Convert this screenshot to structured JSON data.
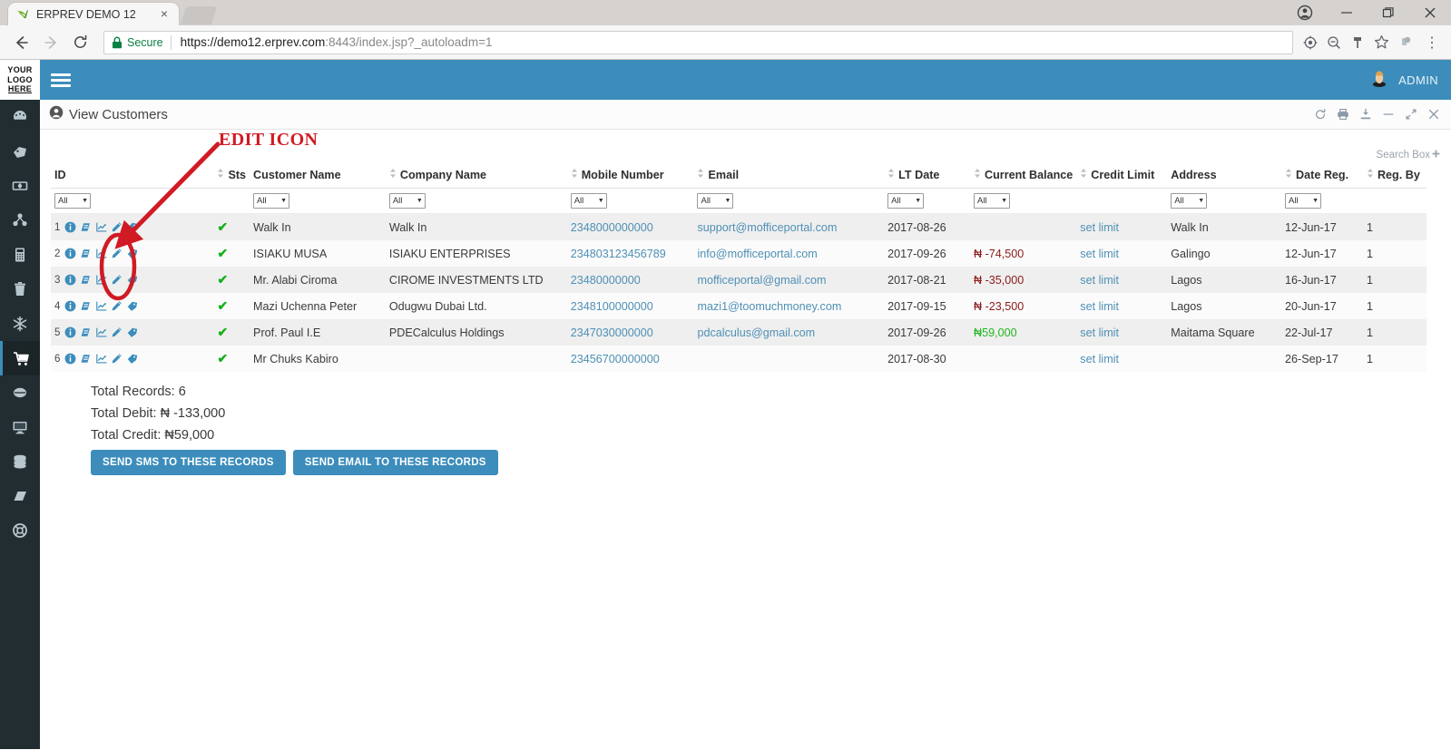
{
  "browser": {
    "tab": {
      "title": "ERPREV DEMO 12",
      "favicon": "erprev-leaf-icon",
      "close": "×"
    },
    "new_tab_label": "new-tab-button",
    "window_buttons": [
      "profile-icon",
      "minimize",
      "maximize",
      "close"
    ],
    "nav": {
      "back": "back-arrow",
      "forward": "forward-arrow",
      "reload": "reload-icon"
    },
    "url": {
      "secure_label": "Secure",
      "scheme_host": "https://demo12.erprev.com",
      "port_path": ":8443/index.jsp?_autoloadm=1",
      "full": "https://demo12.erprev.com:8443/index.jsp?_autoloadm=1"
    },
    "omni_icons": [
      "target-icon",
      "zoom-out-icon",
      "key-icon",
      "star-icon"
    ],
    "extension_icon": "extension-puzzle-icon",
    "menu_icon": "three-dots-icon"
  },
  "sidebar": {
    "logo": {
      "line1": "YOUR",
      "line2": "LOGO",
      "line3": "HERE"
    },
    "items": [
      {
        "icon": "dashboard-icon",
        "active": false
      },
      {
        "icon": "tag-ticket-icon",
        "active": false
      },
      {
        "icon": "money-icon",
        "active": false
      },
      {
        "icon": "network-share-icon",
        "active": false
      },
      {
        "icon": "calculator-icon",
        "active": false
      },
      {
        "icon": "trash-bin-icon",
        "active": false
      },
      {
        "icon": "snowflake-icon",
        "active": false
      },
      {
        "icon": "shopping-cart-icon",
        "active": true
      },
      {
        "icon": "coin-stack-icon",
        "active": false
      },
      {
        "icon": "monitor-icon",
        "active": false
      },
      {
        "icon": "database-icon",
        "active": false
      },
      {
        "icon": "book-icon",
        "active": false
      },
      {
        "icon": "lifebuoy-icon",
        "active": false
      }
    ]
  },
  "topbar": {
    "menu_toggle": "hamburger-menu",
    "user_name": "ADMIN",
    "avatar": "user-avatar-icon"
  },
  "panel": {
    "title": "View Customers",
    "title_icon": "user-circle-icon",
    "tools": [
      {
        "name": "refresh-icon",
        "glyph": "refresh"
      },
      {
        "name": "print-icon",
        "glyph": "print"
      },
      {
        "name": "download-icon",
        "glyph": "download"
      },
      {
        "name": "minimize-icon",
        "glyph": "minus"
      },
      {
        "name": "expand-icon",
        "glyph": "expand"
      },
      {
        "name": "close-icon",
        "glyph": "close"
      }
    ],
    "search_box_label": "Search Box",
    "search_box_plus": "+"
  },
  "table": {
    "columns": [
      {
        "label": "ID",
        "sortable": false,
        "filter": true
      },
      {
        "label": "Sts",
        "sortable": true,
        "filter": false
      },
      {
        "label": "Customer Name",
        "sortable": false,
        "filter": true
      },
      {
        "label": "Company Name",
        "sortable": true,
        "filter": true
      },
      {
        "label": "Mobile Number",
        "sortable": true,
        "filter": true
      },
      {
        "label": "Email",
        "sortable": true,
        "filter": true
      },
      {
        "label": "LT Date",
        "sortable": true,
        "filter": true
      },
      {
        "label": "Current Balance",
        "sortable": true,
        "filter": true
      },
      {
        "label": "Credit Limit",
        "sortable": true,
        "filter": false
      },
      {
        "label": "Address",
        "sortable": false,
        "filter": true
      },
      {
        "label": "Date Reg.",
        "sortable": true,
        "filter": true
      },
      {
        "label": "Reg. By",
        "sortable": true,
        "filter": false
      }
    ],
    "filter_value": "All",
    "row_action_icons": [
      "info-circle-icon",
      "book-icon",
      "chart-line-icon",
      "pencil-edit-icon",
      "tag-icon"
    ],
    "credit_limit_link": "set limit",
    "status_glyph": "✔",
    "rows": [
      {
        "id": "1",
        "status": "active",
        "customer_name": "Walk In",
        "company_name": "Walk In",
        "mobile": "2348000000000",
        "email": "support@mofficeportal.com",
        "lt_date": "2017-08-26",
        "balance": "",
        "balance_sign": "none",
        "credit_limit": "set limit",
        "address": "Walk In",
        "date_reg": "12-Jun-17",
        "reg_by": "1"
      },
      {
        "id": "2",
        "status": "active",
        "customer_name": "ISIAKU MUSA",
        "company_name": "ISIAKU ENTERPRISES",
        "mobile": "234803123456789",
        "email": "info@mofficeportal.com",
        "lt_date": "2017-09-26",
        "balance": "₦ -74,500",
        "balance_sign": "neg",
        "credit_limit": "set limit",
        "address": "Galingo",
        "date_reg": "12-Jun-17",
        "reg_by": "1"
      },
      {
        "id": "3",
        "status": "active",
        "customer_name": "Mr. Alabi Ciroma",
        "company_name": "CIROME INVESTMENTS LTD",
        "mobile": "23480000000",
        "email": "mofficeportal@gmail.com",
        "lt_date": "2017-08-21",
        "balance": "₦ -35,000",
        "balance_sign": "neg",
        "credit_limit": "set limit",
        "address": "Lagos",
        "date_reg": "16-Jun-17",
        "reg_by": "1"
      },
      {
        "id": "4",
        "status": "active",
        "customer_name": "Mazi Uchenna Peter",
        "company_name": "Odugwu Dubai Ltd.",
        "mobile": "2348100000000",
        "email": "mazi1@toomuchmoney.com",
        "lt_date": "2017-09-15",
        "balance": "₦ -23,500",
        "balance_sign": "neg",
        "credit_limit": "set limit",
        "address": "Lagos",
        "date_reg": "20-Jun-17",
        "reg_by": "1"
      },
      {
        "id": "5",
        "status": "active",
        "customer_name": "Prof. Paul I.E",
        "company_name": "PDECalculus Holdings",
        "mobile": "2347030000000",
        "email": "pdcalculus@gmail.com",
        "lt_date": "2017-09-26",
        "balance": "₦59,000",
        "balance_sign": "pos",
        "credit_limit": "set limit",
        "address": "Maitama Square",
        "date_reg": "22-Jul-17",
        "reg_by": "1"
      },
      {
        "id": "6",
        "status": "active",
        "customer_name": "Mr Chuks Kabiro",
        "company_name": "",
        "mobile": "23456700000000",
        "email": "",
        "lt_date": "2017-08-30",
        "balance": "",
        "balance_sign": "none",
        "credit_limit": "set limit",
        "address": "",
        "date_reg": "26-Sep-17",
        "reg_by": "1"
      }
    ]
  },
  "summary": {
    "total_records": "Total Records: 6",
    "total_debit": "Total Debit: ₦ -133,000",
    "total_credit": "Total Credit: ₦59,000",
    "sms_button": "SEND SMS TO THESE RECORDS",
    "email_button": "SEND EMAIL TO THESE RECORDS"
  },
  "annotation": {
    "label": "EDIT ICON",
    "color": "#d01b24",
    "shapes": [
      "arrow-pointing-to-edit-icons",
      "ellipse-highlighting-pencil-column"
    ]
  },
  "colors": {
    "brand_blue": "#3c8dbc",
    "sidebar_dark": "#222d32",
    "link_blue": "#4f90b5",
    "status_green": "#15b01a",
    "negative_red": "#8b1a1a",
    "positive_green": "#1fb81f",
    "annotation_red": "#d01b24"
  }
}
